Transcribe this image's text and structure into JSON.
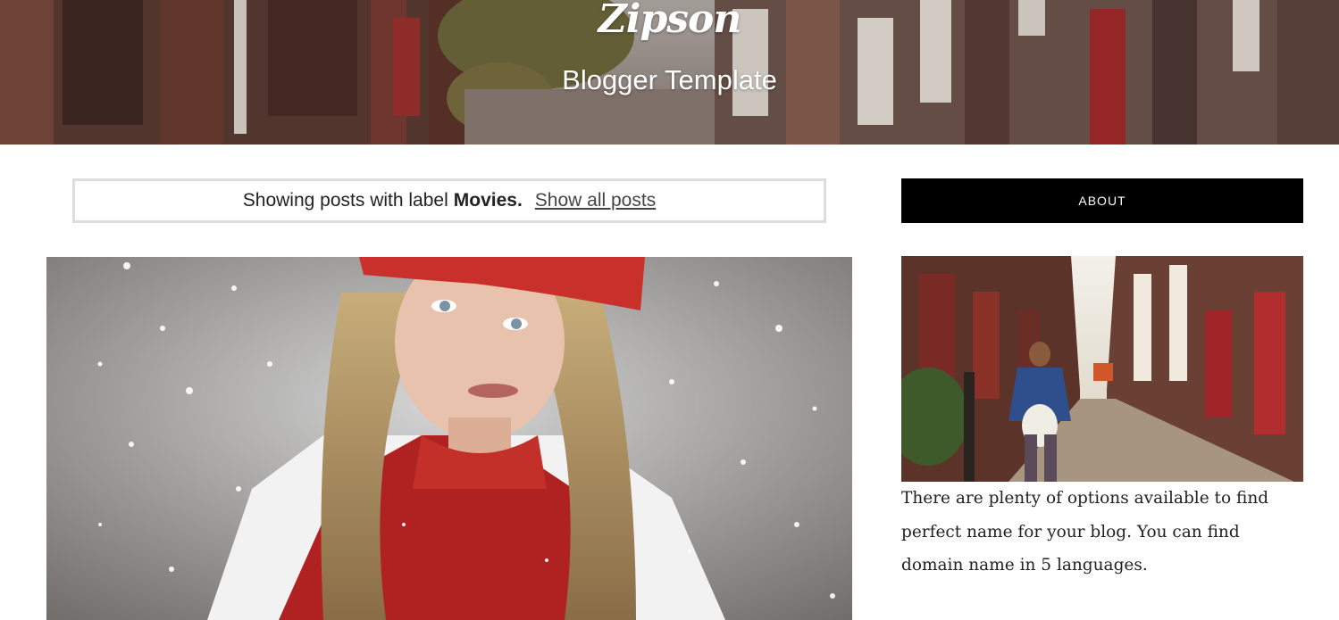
{
  "header": {
    "title": "Zipson",
    "description": "Blogger Template"
  },
  "status": {
    "prefix": "Showing posts with label",
    "label": "Movies",
    "dot": ".",
    "show_all": "Show all posts"
  },
  "post": {
    "image_alt": "Girl in red hat in snow"
  },
  "sidebar": {
    "about_title": "ABOUT",
    "about_image_alt": "Woman walking down a brick street",
    "about_text": "There are plenty of options available to find perfect name for your blog. You can find domain name in 5 languages."
  },
  "colors": {
    "about_bar_bg": "#000000",
    "status_border": "#dddddd",
    "text": "#222222"
  }
}
